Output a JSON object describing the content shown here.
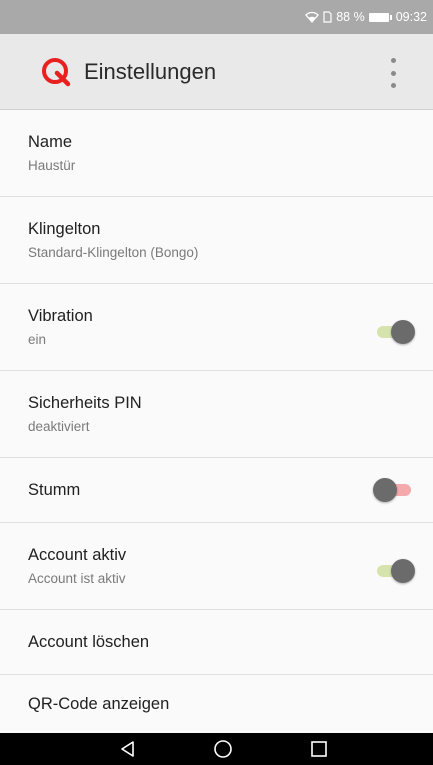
{
  "status_bar": {
    "battery_percent": "88 %",
    "time": "09:32"
  },
  "app_bar": {
    "title": "Einstellungen",
    "logo_color": "#e8201f"
  },
  "settings": [
    {
      "label": "Name",
      "sublabel": "Haustür"
    },
    {
      "label": "Klingelton",
      "sublabel": "Standard-Klingelton (Bongo)"
    },
    {
      "label": "Vibration",
      "sublabel": "ein",
      "toggle": true
    },
    {
      "label": "Sicherheits PIN",
      "sublabel": "deaktiviert"
    },
    {
      "label": "Stumm",
      "toggle": false
    },
    {
      "label": "Account aktiv",
      "sublabel": "Account ist aktiv",
      "toggle": true
    },
    {
      "label": "Account löschen"
    },
    {
      "label": "QR-Code anzeigen"
    }
  ],
  "nav_bar": {
    "buttons": [
      "back-icon",
      "home-icon",
      "recents-icon"
    ]
  }
}
